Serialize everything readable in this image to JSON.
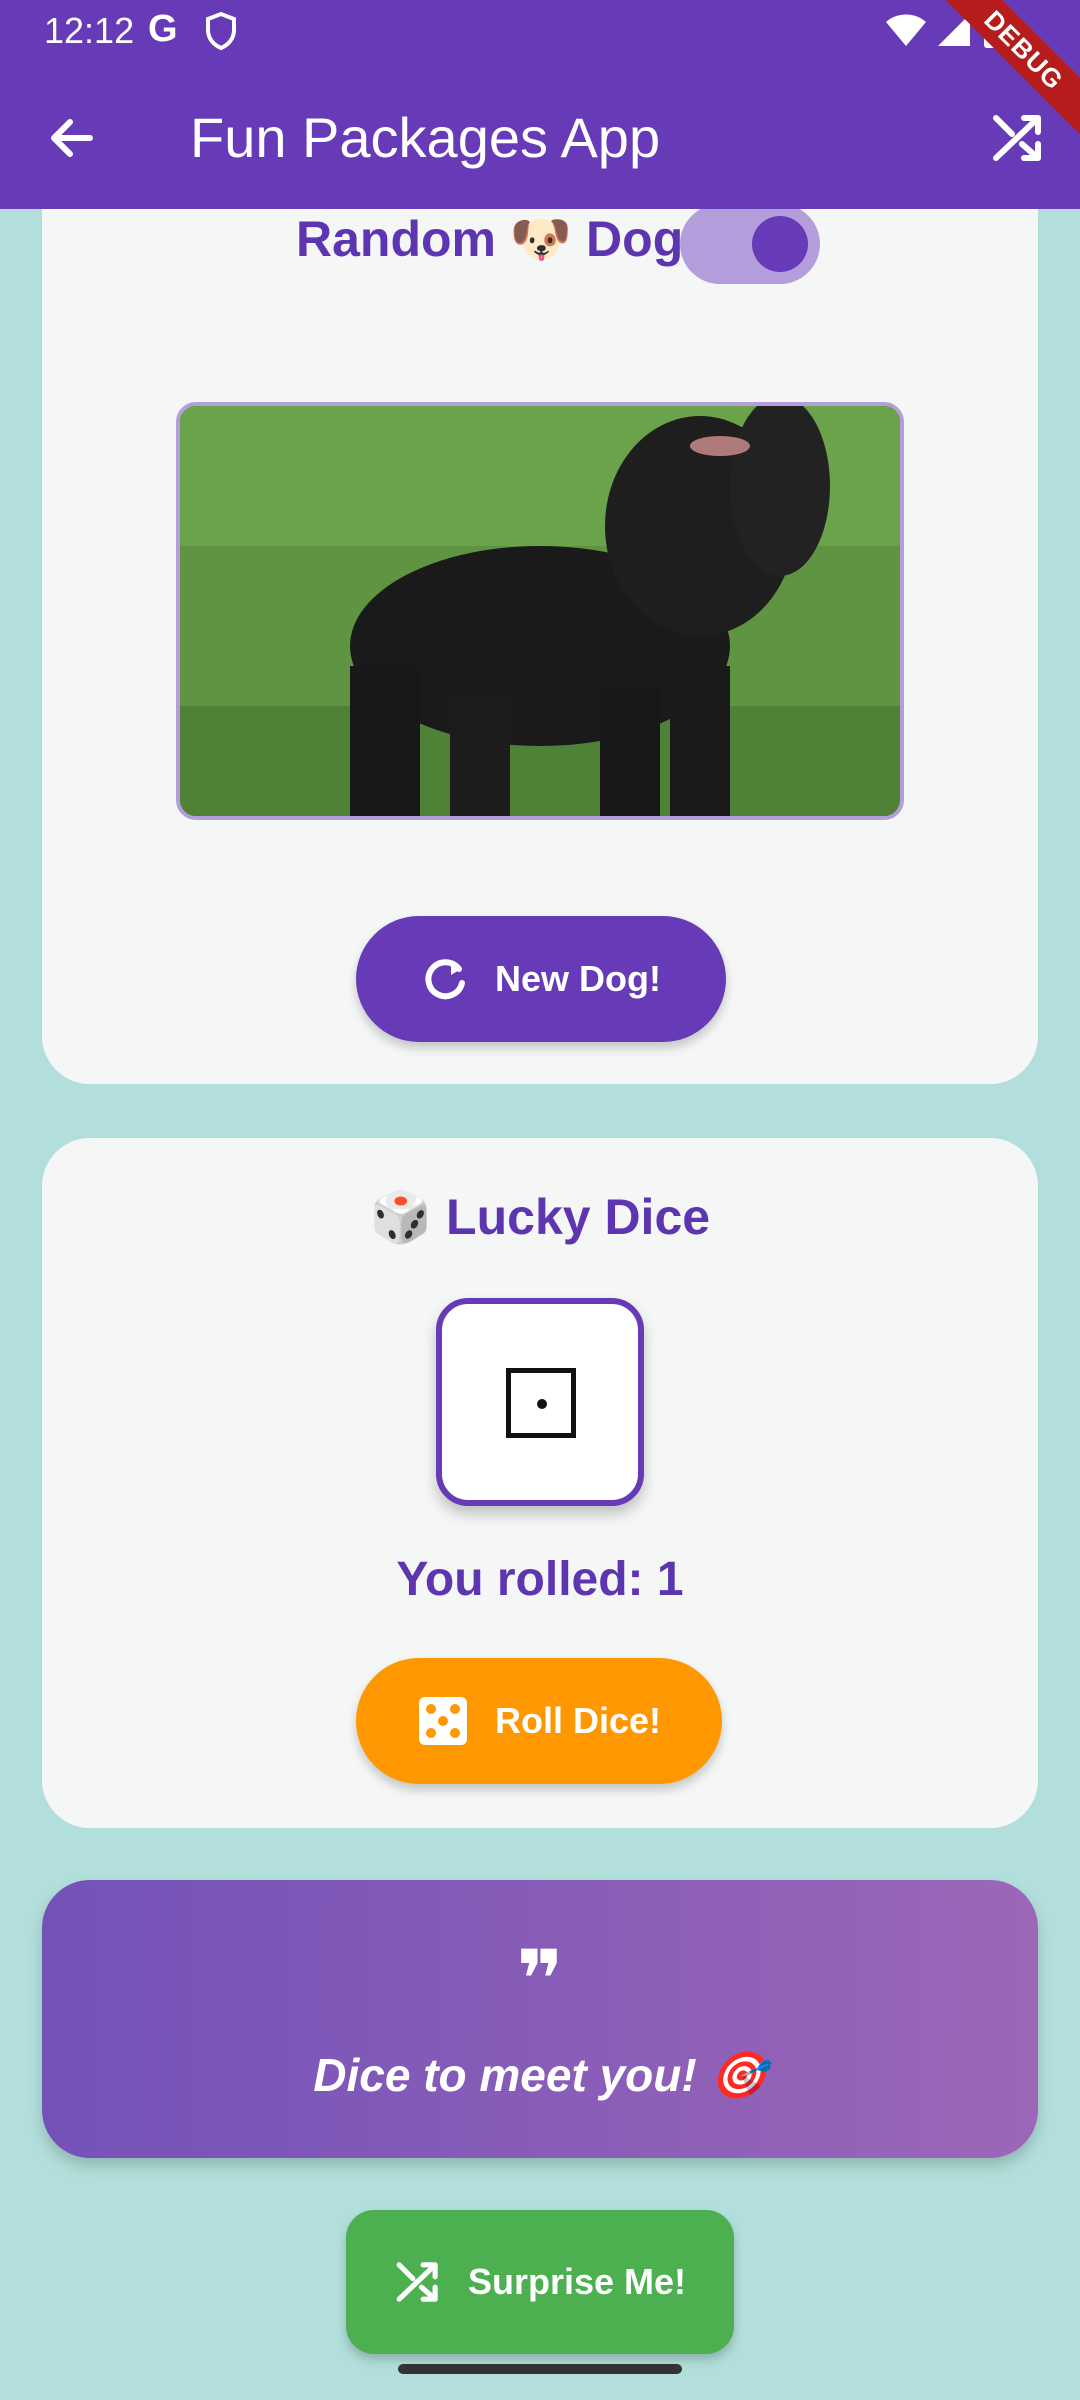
{
  "status_bar": {
    "time": "12:12",
    "g_label": "G",
    "debug": "DEBUG"
  },
  "app_bar": {
    "title": "Fun Packages App",
    "back_icon": "arrow-back-icon",
    "action_icon": "shuffle-icon"
  },
  "dog_card": {
    "title": "Random 🐶 Dog",
    "toggle_on": true,
    "image": "black-poodle-dog-photo",
    "button_label": "New Dog!",
    "button_icon": "refresh-icon"
  },
  "dice_card": {
    "title": "🎲 Lucky Dice",
    "rolled_text": "You rolled: 1",
    "die_value": 1,
    "button_label": "Roll Dice!",
    "button_icon": "dice-five-icon"
  },
  "quote_card": {
    "mark": "❞",
    "text": "Dice to meet you! 🎯"
  },
  "fab": {
    "label": "Surprise Me!",
    "icon": "shuffle-icon"
  },
  "colors": {
    "primary": "#673ab7",
    "background": "#b2dfdb",
    "card": "#f5f7f7",
    "orange": "#ff9800",
    "green": "#4caf50"
  }
}
